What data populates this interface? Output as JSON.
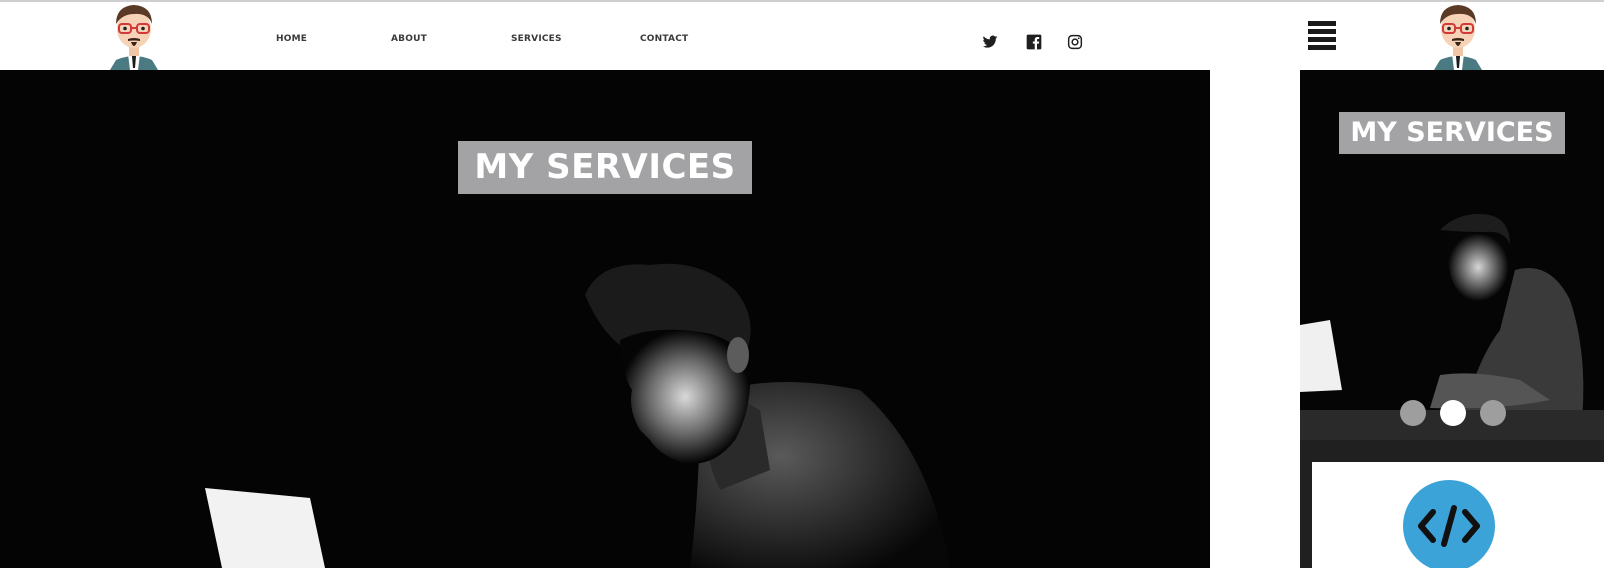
{
  "nav": {
    "links": [
      "Home",
      "About",
      "Services",
      "Contact"
    ]
  },
  "social": [
    "twitter-icon",
    "facebook-icon",
    "instagram-icon"
  ],
  "hero": {
    "title": "My Services"
  },
  "mobile": {
    "title": "My Services",
    "slider": {
      "count": 3,
      "active": 2
    },
    "card_icon": "code-icon"
  },
  "colors": {
    "title_box": "#a3a3a5",
    "hero_bg": "#040404",
    "code_badge": "#3ba3d8",
    "dot_active": "#ffffff",
    "dot_inactive": "#9e9e9e"
  }
}
